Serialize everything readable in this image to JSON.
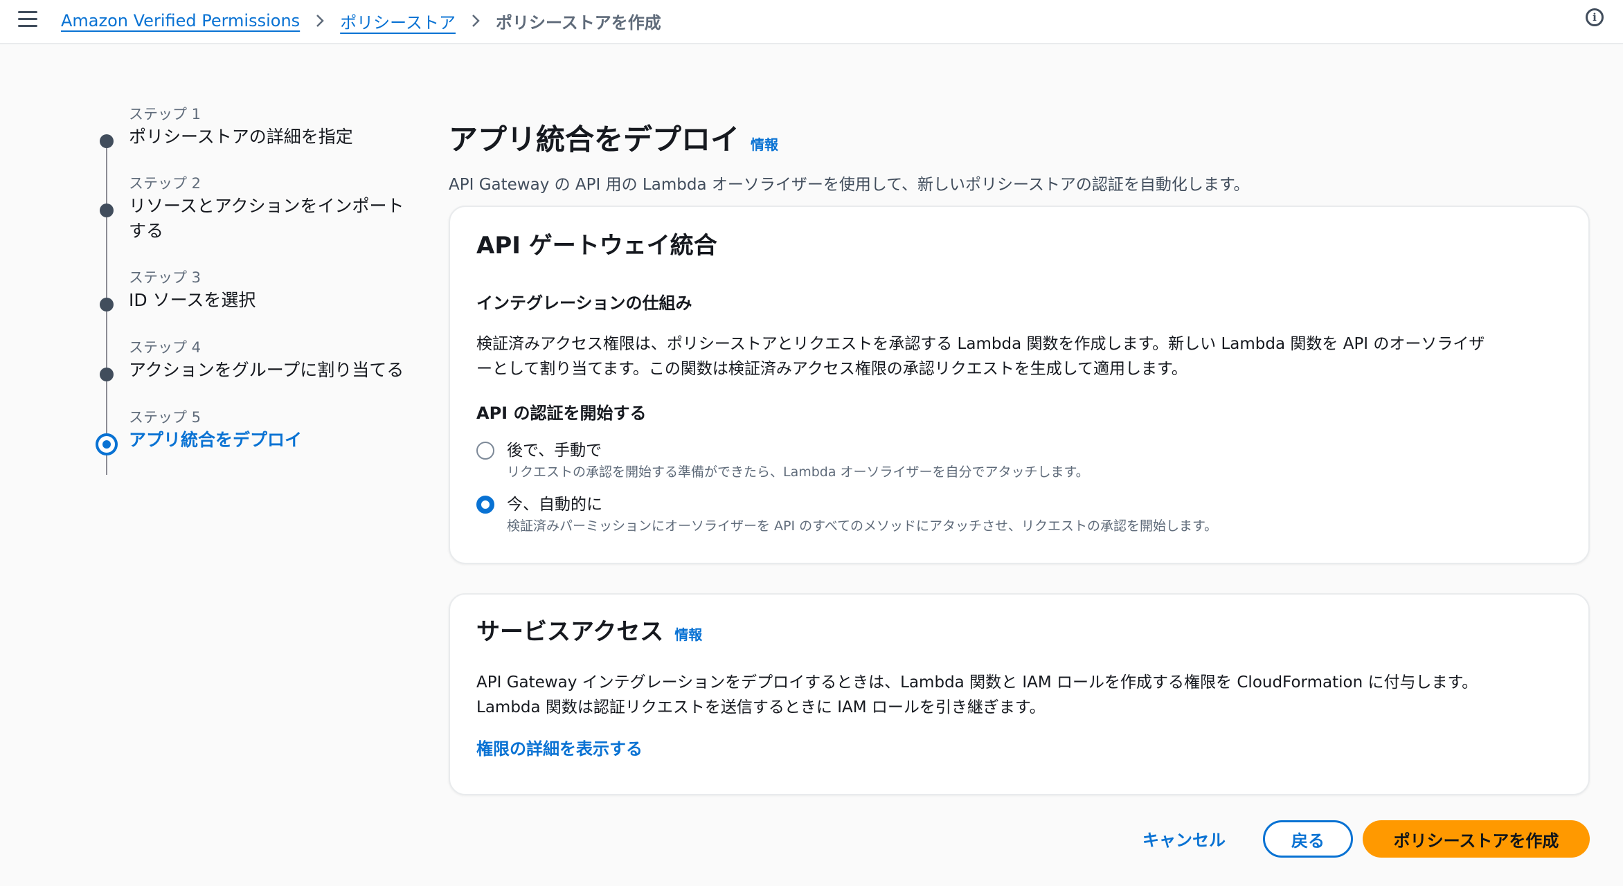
{
  "breadcrumb": {
    "items": [
      "Amazon Verified Permissions",
      "ポリシーストア"
    ],
    "current": "ポリシーストアを作成"
  },
  "stepper": {
    "steps": [
      {
        "num": "ステップ 1",
        "title": "ポリシーストアの詳細を指定"
      },
      {
        "num": "ステップ 2",
        "title_line1": "リソースとアクションをインポート",
        "title_line2": "する"
      },
      {
        "num": "ステップ 3",
        "title": "ID ソースを選択"
      },
      {
        "num": "ステップ 4",
        "title": "アクションをグループに割り当てる"
      },
      {
        "num": "ステップ 5",
        "title": "アプリ統合をデプロイ"
      }
    ]
  },
  "header": {
    "title": "アプリ統合をデプロイ",
    "info": "情報",
    "subtitle": "API Gateway の API 用の Lambda オーソライザーを使用して、新しいポリシーストアの認証を自動化します。"
  },
  "api_card": {
    "title": "API ゲートウェイ統合",
    "how_title": "インテグレーションの仕組み",
    "how_line1": "検証済みアクセス権限は、ポリシーストアとリクエストを承認する Lambda 関数を作成します。新しい Lambda 関数を API のオーソライザ",
    "how_line2": "ーとして割り当てます。この関数は検証済みアクセス権限の承認リクエストを生成して適用します。",
    "auth_title": "API の認証を開始する",
    "options": [
      {
        "label": "後で、手動で",
        "desc": "リクエストの承認を開始する準備ができたら、Lambda オーソライザーを自分でアタッチします。",
        "checked": false
      },
      {
        "label": "今、自動的に",
        "desc": "検証済みパーミッションにオーソライザーを API のすべてのメソッドにアタッチさせ、リクエストの承認を開始します。",
        "checked": true
      }
    ]
  },
  "service_card": {
    "title": "サービスアクセス",
    "info": "情報",
    "line1": "API Gateway インテグレーションをデプロイするときは、Lambda 関数と IAM ロールを作成する権限を CloudFormation に付与します。",
    "line2": "Lambda 関数は認証リクエストを送信するときに IAM ロールを引き継ぎます。",
    "link": "権限の詳細を表示する"
  },
  "footer": {
    "cancel": "キャンセル",
    "back": "戻る",
    "create": "ポリシーストアを作成"
  },
  "colors": {
    "accent": "#0972d3",
    "primary_button": "#ff9900"
  }
}
